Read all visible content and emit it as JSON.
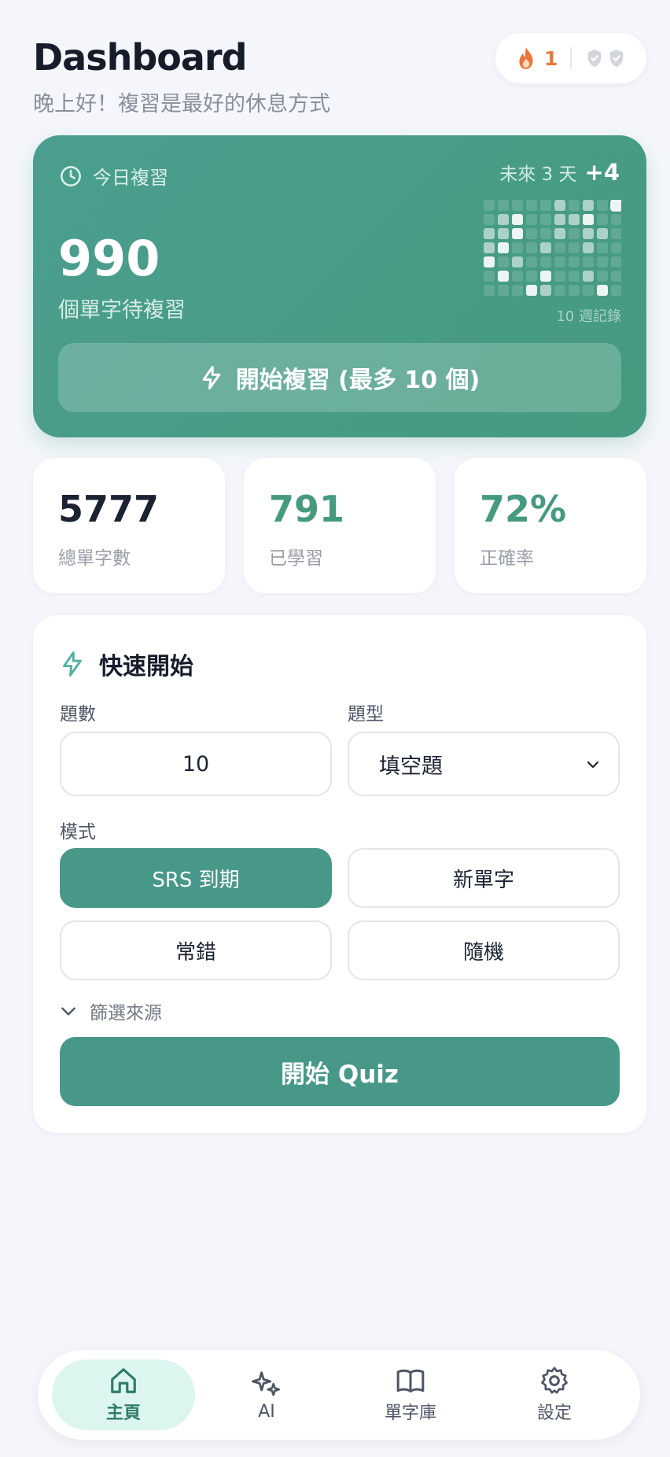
{
  "header": {
    "title": "Dashboard",
    "greeting": "晚上好！複習是最好的休息方式",
    "streak_count": "1",
    "icons": [
      "flame-icon",
      "shield-icon"
    ]
  },
  "review": {
    "label": "今日複習",
    "future_label": "未來 3 天",
    "future_value": "+4",
    "due_count": "990",
    "due_label": "個單字待複習",
    "heatmap_caption": "10 週記錄",
    "heatmap_levels": [
      [
        1,
        1,
        1,
        1,
        1,
        2,
        1,
        2,
        1,
        3
      ],
      [
        1,
        2,
        3,
        1,
        1,
        2,
        2,
        3,
        1,
        1
      ],
      [
        2,
        2,
        3,
        1,
        1,
        2,
        1,
        2,
        2,
        1
      ],
      [
        2,
        3,
        1,
        1,
        2,
        1,
        1,
        2,
        1,
        1
      ],
      [
        3,
        1,
        2,
        1,
        1,
        1,
        1,
        1,
        1,
        1
      ],
      [
        1,
        3,
        1,
        1,
        3,
        1,
        1,
        2,
        1,
        1
      ],
      [
        1,
        1,
        1,
        3,
        2,
        1,
        1,
        1,
        3,
        1
      ]
    ],
    "start_button": "開始複習 (最多 10 個)"
  },
  "stats": [
    {
      "value": "5777",
      "label": "總單字數",
      "color": "#1b2232"
    },
    {
      "value": "791",
      "label": "已學習",
      "color": "#459a7f"
    },
    {
      "value": "72%",
      "label": "正確率",
      "color": "#459a7f"
    }
  ],
  "quick_start": {
    "title": "快速開始",
    "count_label": "題數",
    "count_value": "10",
    "type_label": "題型",
    "type_value": "填空題",
    "mode_label": "模式",
    "modes": [
      {
        "label": "SRS 到期",
        "active": true
      },
      {
        "label": "新單字",
        "active": false
      },
      {
        "label": "常錯",
        "active": false
      },
      {
        "label": "隨機",
        "active": false
      }
    ],
    "filter_label": "篩選來源",
    "start_button": "開始 Quiz"
  },
  "nav": {
    "items": [
      {
        "label": "主頁",
        "icon": "home-icon",
        "active": true
      },
      {
        "label": "AI",
        "icon": "sparkle-icon",
        "active": false
      },
      {
        "label": "單字庫",
        "icon": "book-icon",
        "active": false
      },
      {
        "label": "設定",
        "icon": "gear-icon",
        "active": false
      }
    ]
  },
  "colors": {
    "accent": "#48988a",
    "card_gradient_start": "#4b9e8f",
    "card_gradient_end": "#459a7f",
    "streak": "#e8783a",
    "background": "#f4f6fb"
  }
}
